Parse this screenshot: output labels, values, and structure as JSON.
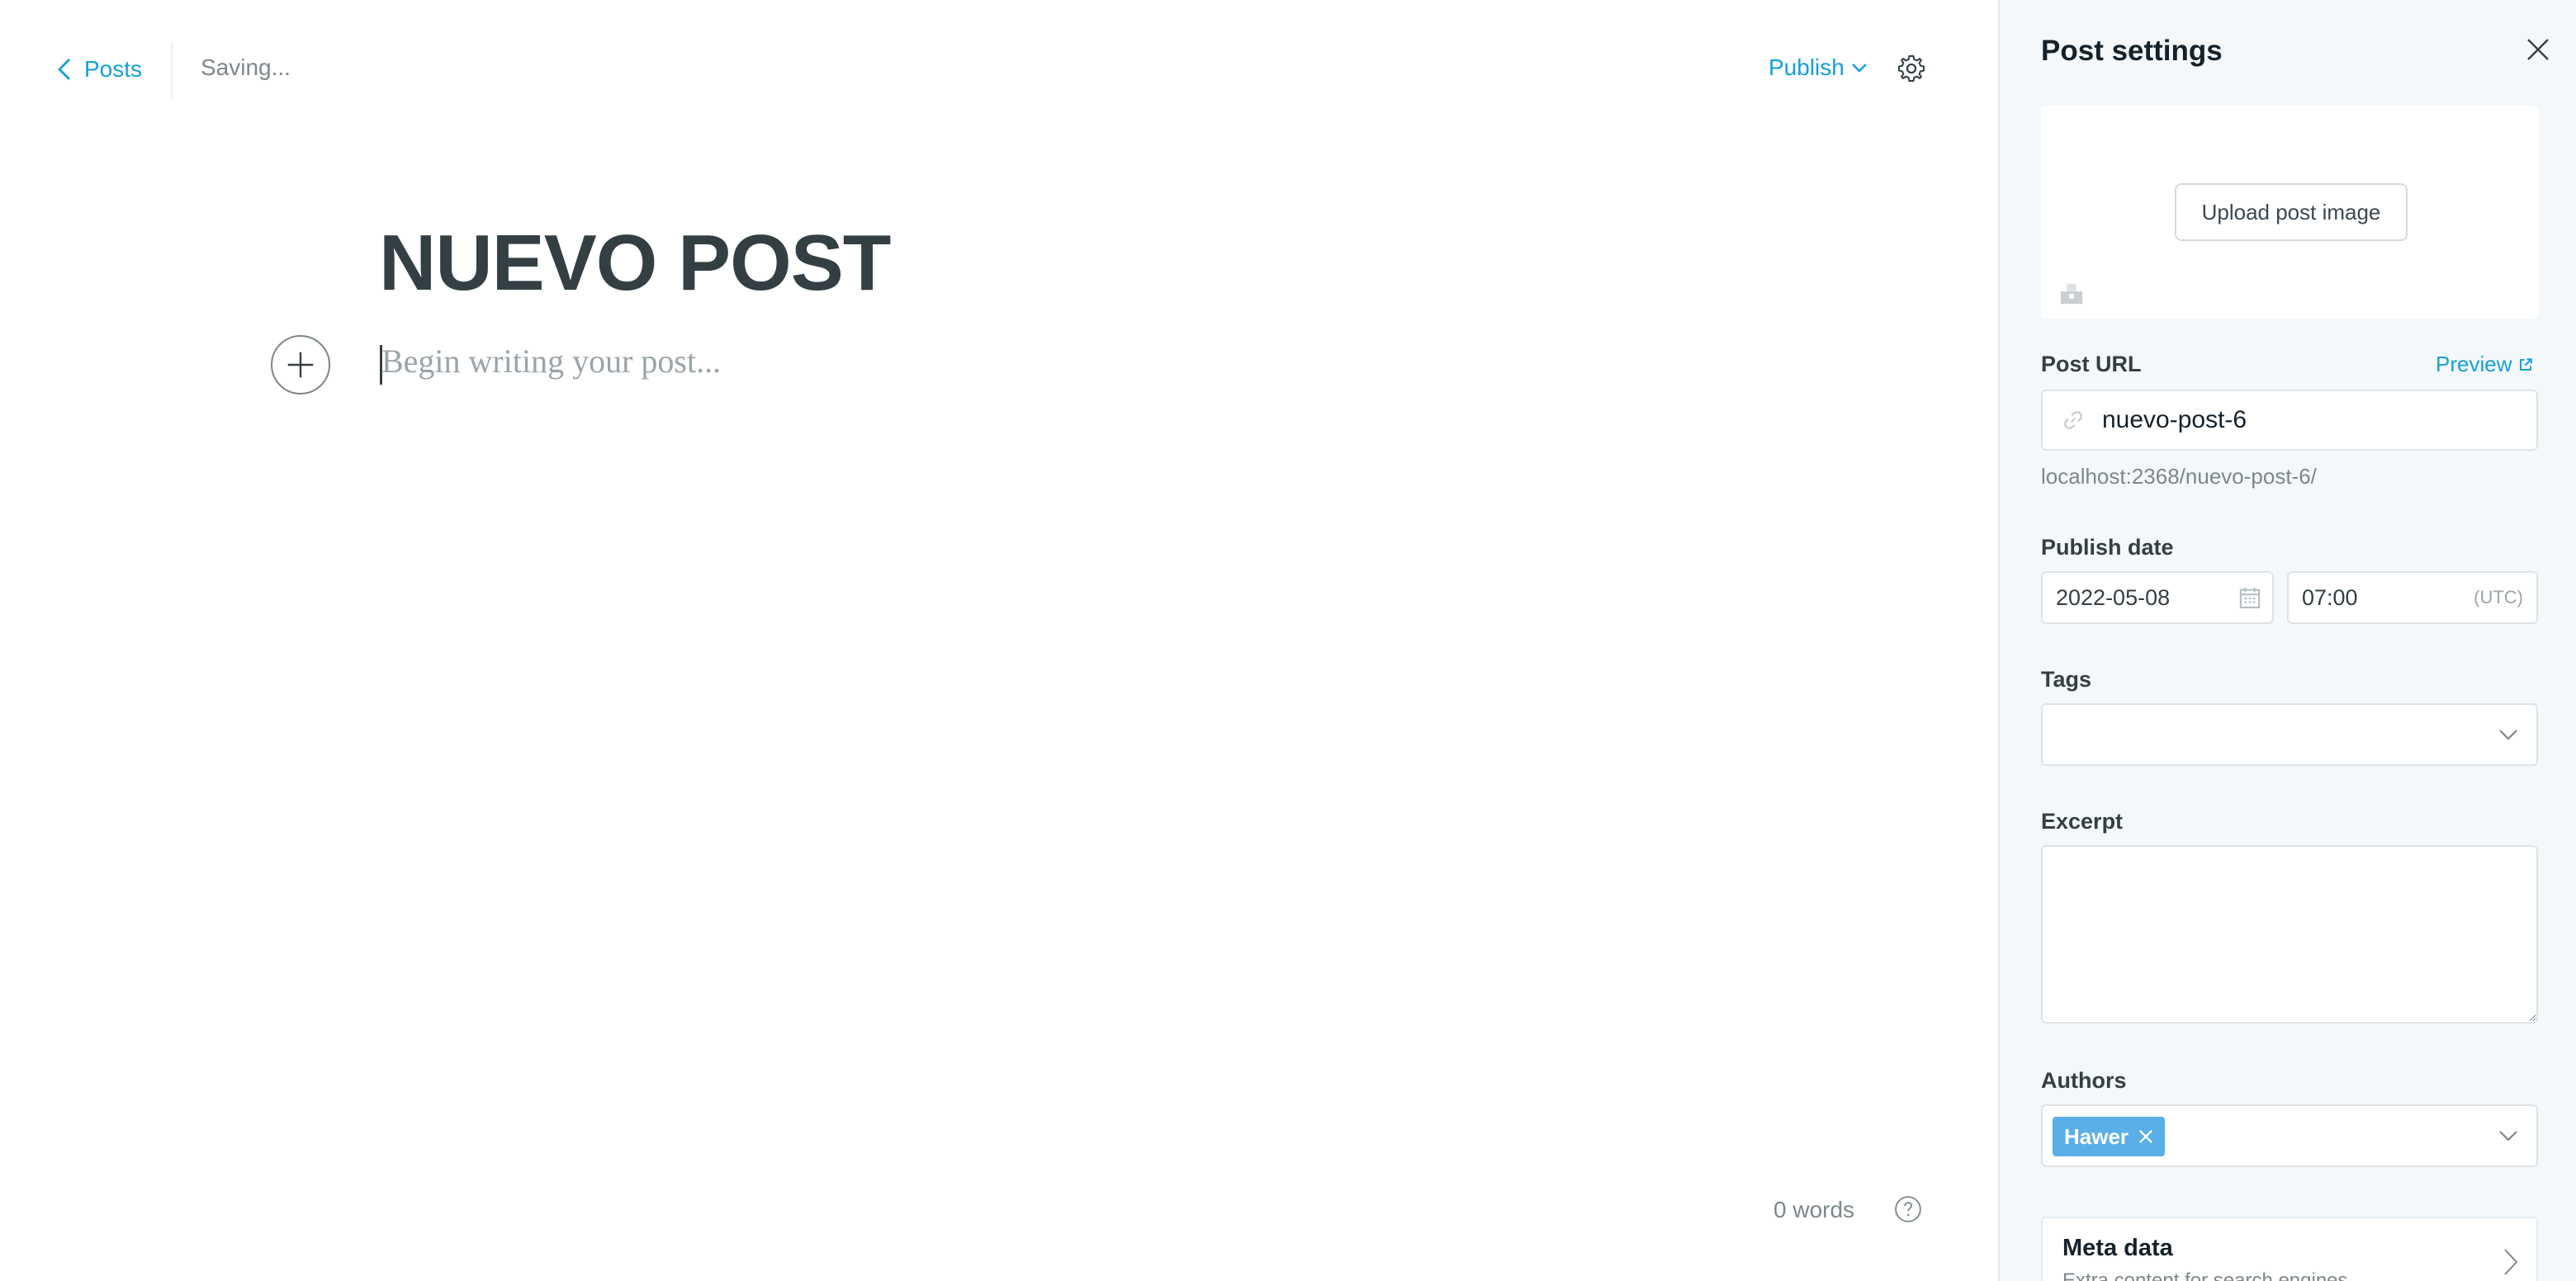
{
  "editor": {
    "back_label": "Posts",
    "status": "Saving...",
    "publish_label": "Publish",
    "title": "NUEVO POST",
    "body_placeholder": "Begin writing your post...",
    "word_count": "0 words"
  },
  "settings": {
    "title": "Post settings",
    "upload_label": "Upload post image",
    "post_url_label": "Post URL",
    "preview_label": "Preview",
    "slug": "nuevo-post-6",
    "url_hint": "localhost:2368/nuevo-post-6/",
    "publish_date_label": "Publish date",
    "date": "2022-05-08",
    "time": "07:00",
    "timezone": "(UTC)",
    "tags_label": "Tags",
    "excerpt_label": "Excerpt",
    "authors_label": "Authors",
    "author": "Hawer",
    "meta_title": "Meta data",
    "meta_subtitle": "Extra content for search engines"
  },
  "colors": {
    "accent": "#14a0dc",
    "author_chip": "#5ab0e6",
    "panel_bg": "#f4f8fb"
  },
  "icons": [
    "chevron-left-icon",
    "chevron-down-icon",
    "gear-icon",
    "plus-icon",
    "help-icon",
    "close-icon",
    "image-icon",
    "external-link-icon",
    "link-icon",
    "calendar-icon",
    "chevron-right-icon"
  ]
}
